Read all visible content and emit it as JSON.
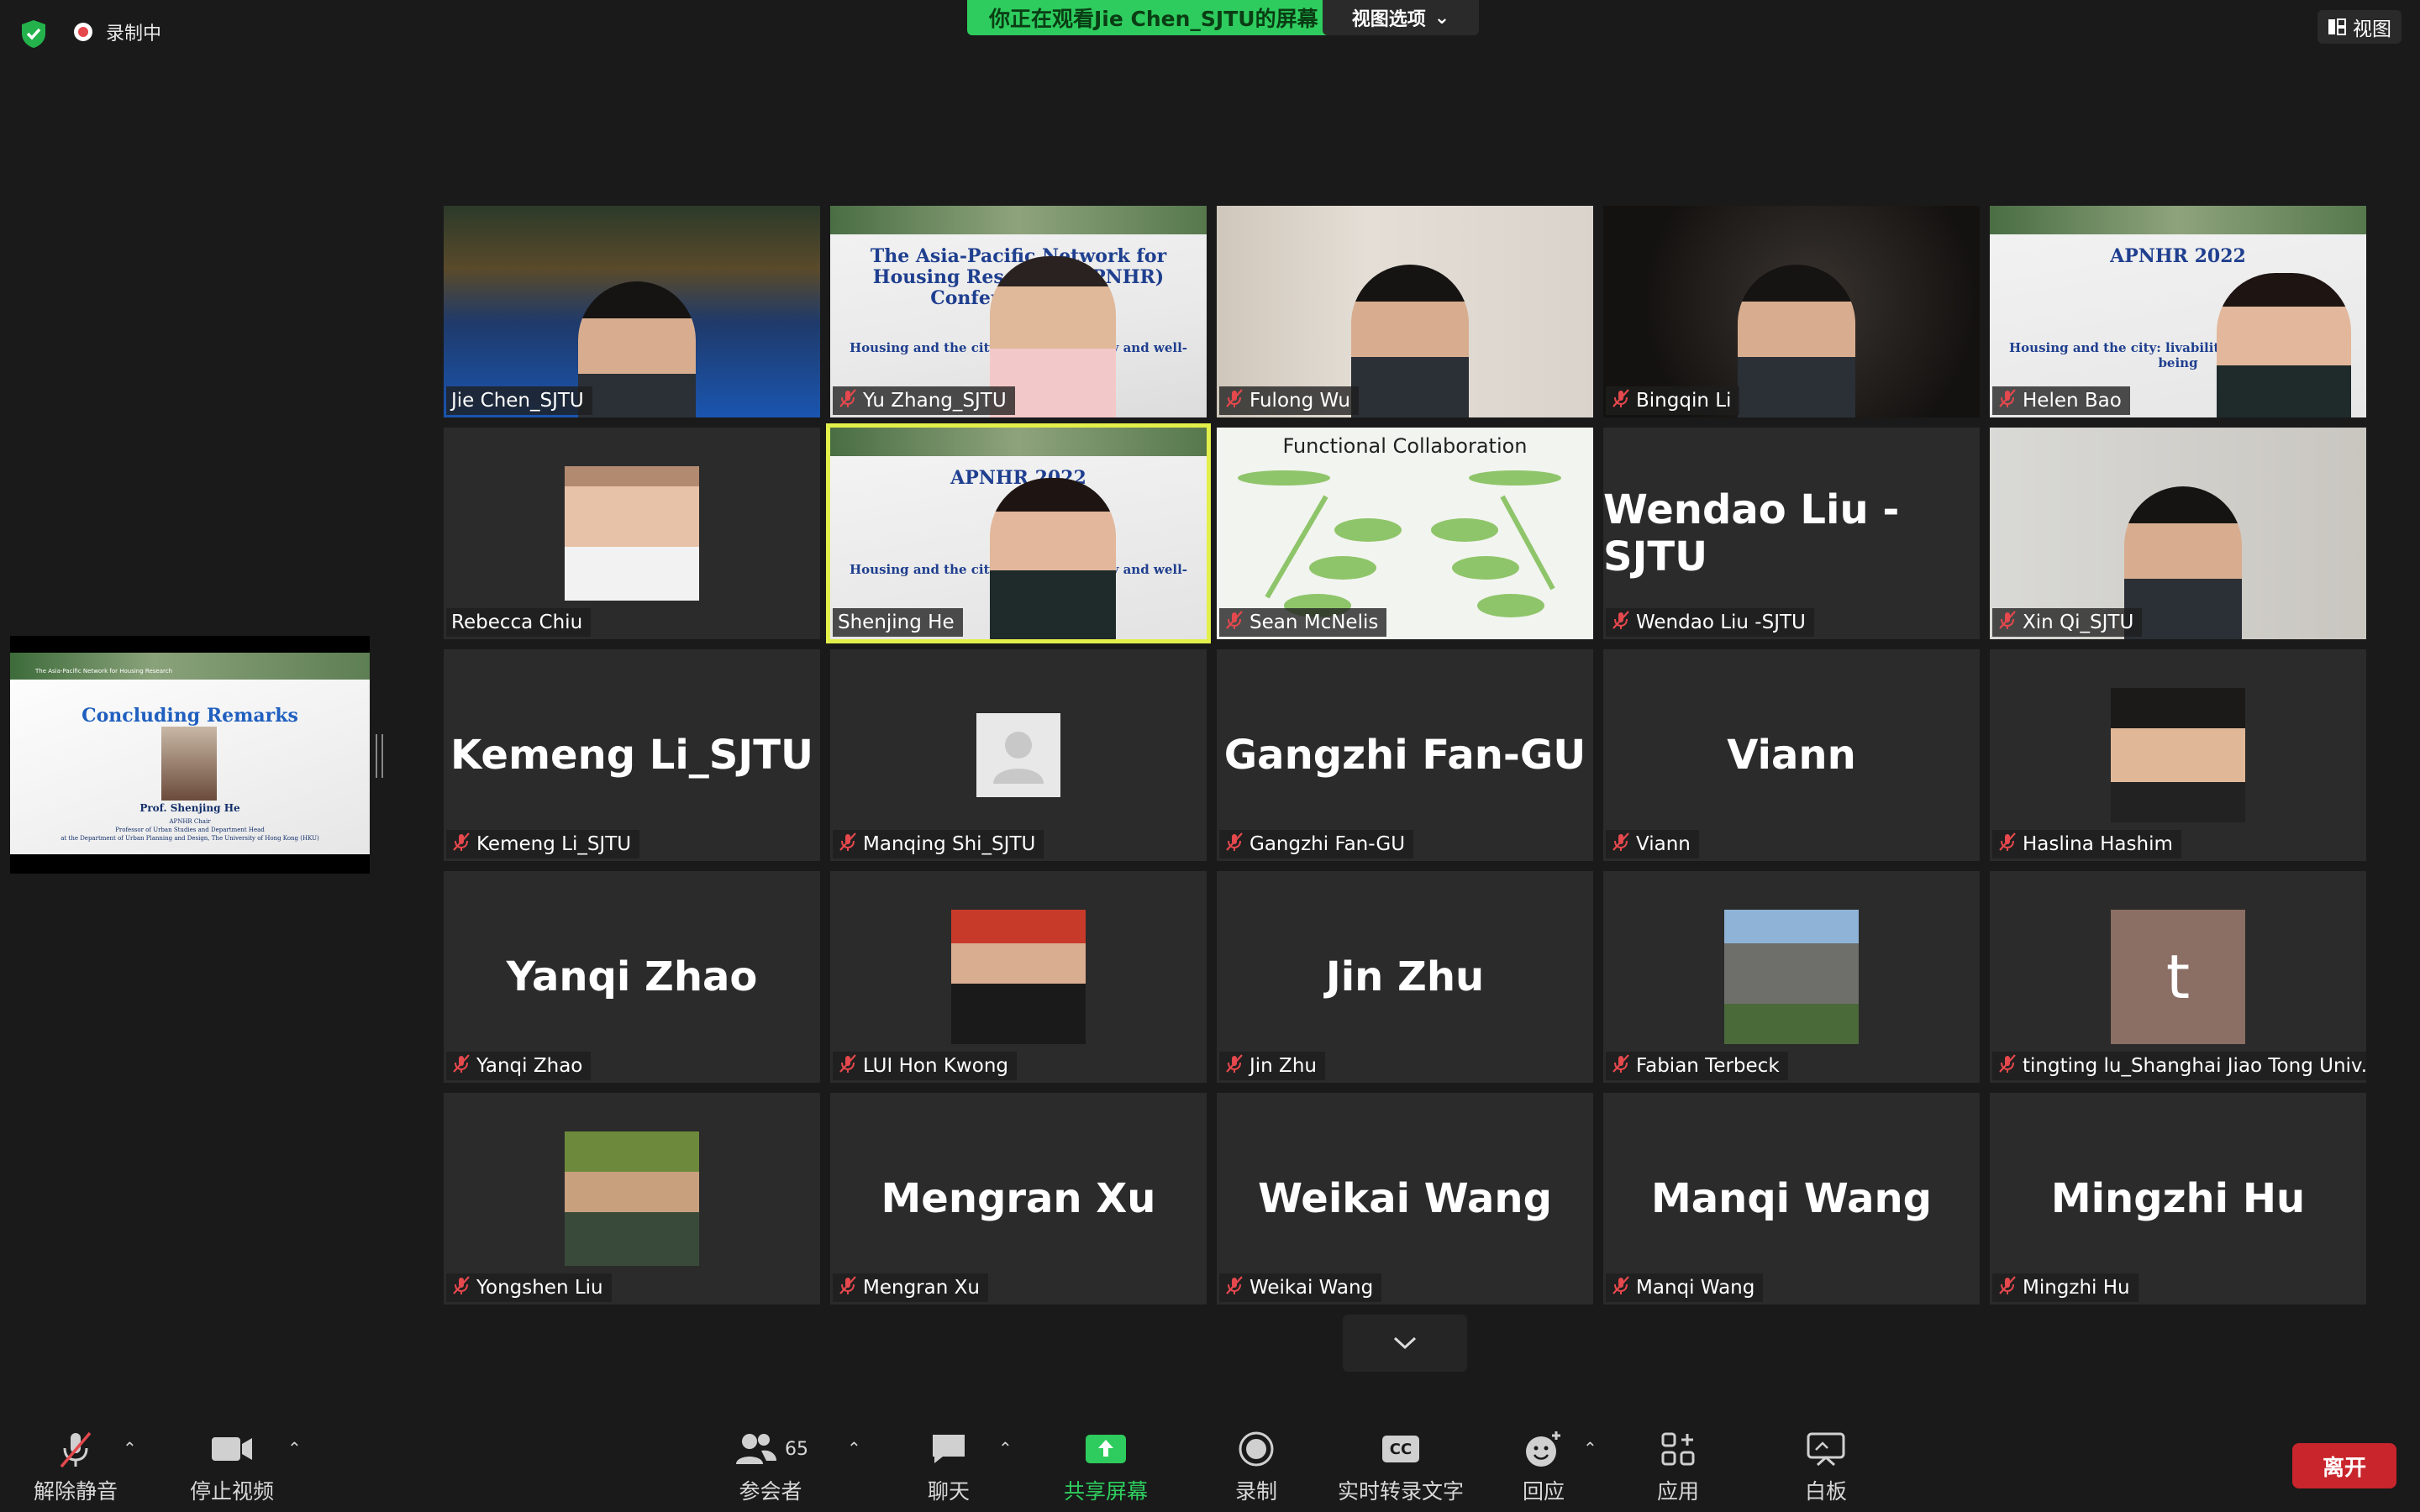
{
  "top": {
    "recording_label": "录制中",
    "share_banner": "你正在观看Jie Chen_SJTU的屏幕",
    "view_options": "视图选项",
    "view_button": "视图"
  },
  "share_thumbnail": {
    "header_org": "The Asia-Pacific Network for Housing Research",
    "title": "Concluding Remarks",
    "speaker": "Prof. Shenjing He",
    "line1": "APNHR Chair",
    "line2": "Professor of Urban Studies and Department Head",
    "line3": "at the Department of Urban Planning and Design, The University of Hong Kong (HKU)"
  },
  "participants": [
    {
      "name": "Jie Chen_SJTU",
      "kind": "video",
      "muted": false
    },
    {
      "name": "Yu Zhang_SJTU",
      "kind": "video",
      "muted": true,
      "slide_title": "The Asia-Pacific Network for Housing Research (APNHR) Conference 2022",
      "slide_sub": "Housing and the city: livability, equity and well-being"
    },
    {
      "name": "Fulong Wu",
      "kind": "video",
      "muted": true
    },
    {
      "name": "Bingqin Li",
      "kind": "video",
      "muted": true
    },
    {
      "name": "Helen Bao",
      "kind": "video",
      "muted": true,
      "slide_title": "APNHR 2022",
      "slide_sub": "Housing and the city: livability, equity and well-being"
    },
    {
      "name": "Rebecca Chiu",
      "kind": "photo",
      "muted": false
    },
    {
      "name": "Shenjing He",
      "kind": "video",
      "muted": false,
      "active": true,
      "slide_title": "APNHR 2022",
      "slide_sub": "Housing and the city: livability, equity and well-being"
    },
    {
      "name": "Sean McNelis",
      "kind": "slide",
      "muted": true,
      "slide_title": "Functional Collaboration"
    },
    {
      "name": "Wendao Liu -SJTU",
      "kind": "name",
      "muted": true
    },
    {
      "name": "Xin Qi_SJTU",
      "kind": "video",
      "muted": true
    },
    {
      "name": "Kemeng Li_SJTU",
      "kind": "name",
      "muted": true
    },
    {
      "name": "Manqing Shi_SJTU",
      "kind": "default-avatar",
      "muted": true
    },
    {
      "name": "Gangzhi Fan-GU",
      "kind": "name",
      "muted": true
    },
    {
      "name": "Viann",
      "kind": "name",
      "muted": true
    },
    {
      "name": "Haslina Hashim",
      "kind": "photo",
      "muted": true
    },
    {
      "name": "Yanqi Zhao",
      "kind": "name",
      "muted": true
    },
    {
      "name": "LUI Hon Kwong",
      "kind": "photo",
      "muted": true
    },
    {
      "name": "Jin Zhu",
      "kind": "name",
      "muted": true
    },
    {
      "name": "Fabian Terbeck",
      "kind": "photo",
      "muted": true
    },
    {
      "name": "tingting lu_Shanghai Jiao Tong Univ...",
      "kind": "letter",
      "letter": "t",
      "muted": true
    },
    {
      "name": "Yongshen Liu",
      "kind": "photo",
      "muted": true
    },
    {
      "name": "Mengran Xu",
      "kind": "name",
      "muted": true
    },
    {
      "name": "Weikai Wang",
      "kind": "name",
      "muted": true
    },
    {
      "name": "Manqi Wang",
      "kind": "name",
      "muted": true
    },
    {
      "name": "Mingzhi Hu",
      "kind": "name",
      "muted": true
    }
  ],
  "big_names": {
    "Wendao Liu -SJTU": "Wendao Liu -SJTU",
    "Kemeng Li_SJTU": "Kemeng Li_SJTU",
    "Gangzhi Fan-GU": "Gangzhi Fan-GU",
    "Viann": "Viann",
    "Yanqi Zhao": "Yanqi Zhao",
    "Jin Zhu": "Jin Zhu",
    "Mengran Xu": "Mengran Xu",
    "Weikai Wang": "Weikai Wang",
    "Manqi Wang": "Manqi Wang",
    "Mingzhi Hu": "Mingzhi Hu"
  },
  "toolbar": {
    "unmute": "解除静音",
    "stop_video": "停止视频",
    "participants": "参会者",
    "participant_count": "65",
    "chat": "聊天",
    "share_screen": "共享屏幕",
    "record": "录制",
    "live_transcript": "实时转录文字",
    "cc_badge": "CC",
    "reactions": "回应",
    "apps": "应用",
    "whiteboard": "白板",
    "leave": "离开"
  },
  "colors": {
    "share_green": "#2ecc5e",
    "active_speaker": "#e3ef4a",
    "muted_red": "#e5484d",
    "leave_red": "#c9252c"
  }
}
